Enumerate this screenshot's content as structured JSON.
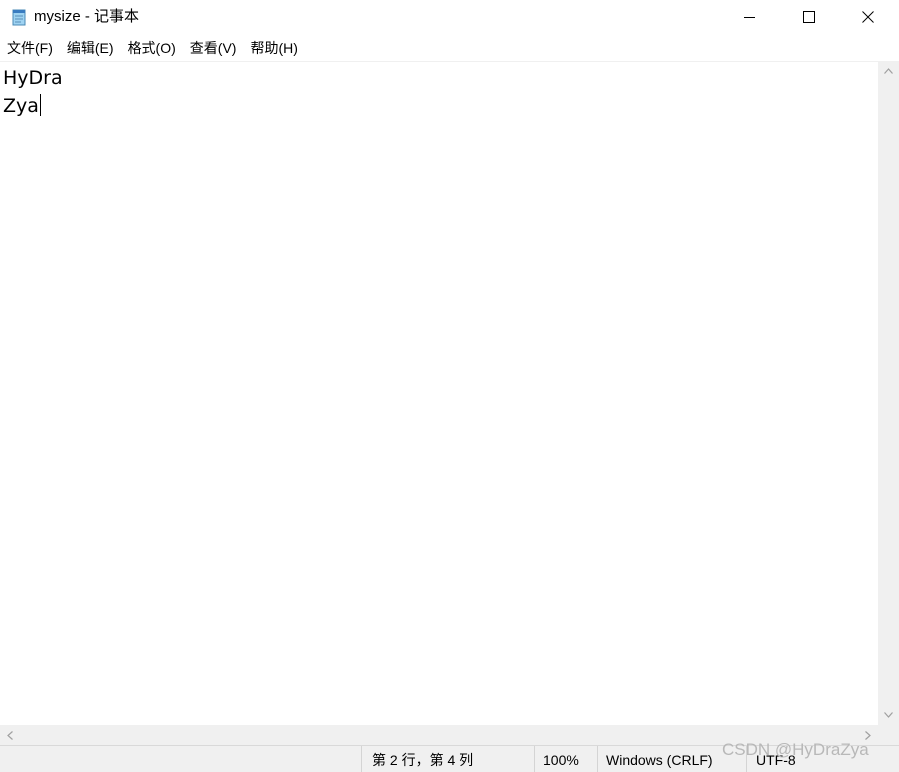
{
  "window": {
    "title": "mysize - 记事本",
    "app_icon": "notepad-icon"
  },
  "menu": {
    "items": [
      {
        "label": "文件(F)"
      },
      {
        "label": "编辑(E)"
      },
      {
        "label": "格式(O)"
      },
      {
        "label": "查看(V)"
      },
      {
        "label": "帮助(H)"
      }
    ]
  },
  "editor": {
    "lines": [
      "HyDra",
      "Zya"
    ]
  },
  "statusbar": {
    "position": "第 2 行，第 4 列",
    "zoom": "100%",
    "line_ending": "Windows (CRLF)",
    "encoding": "UTF-8"
  },
  "watermark": "CSDN @HyDraZya"
}
